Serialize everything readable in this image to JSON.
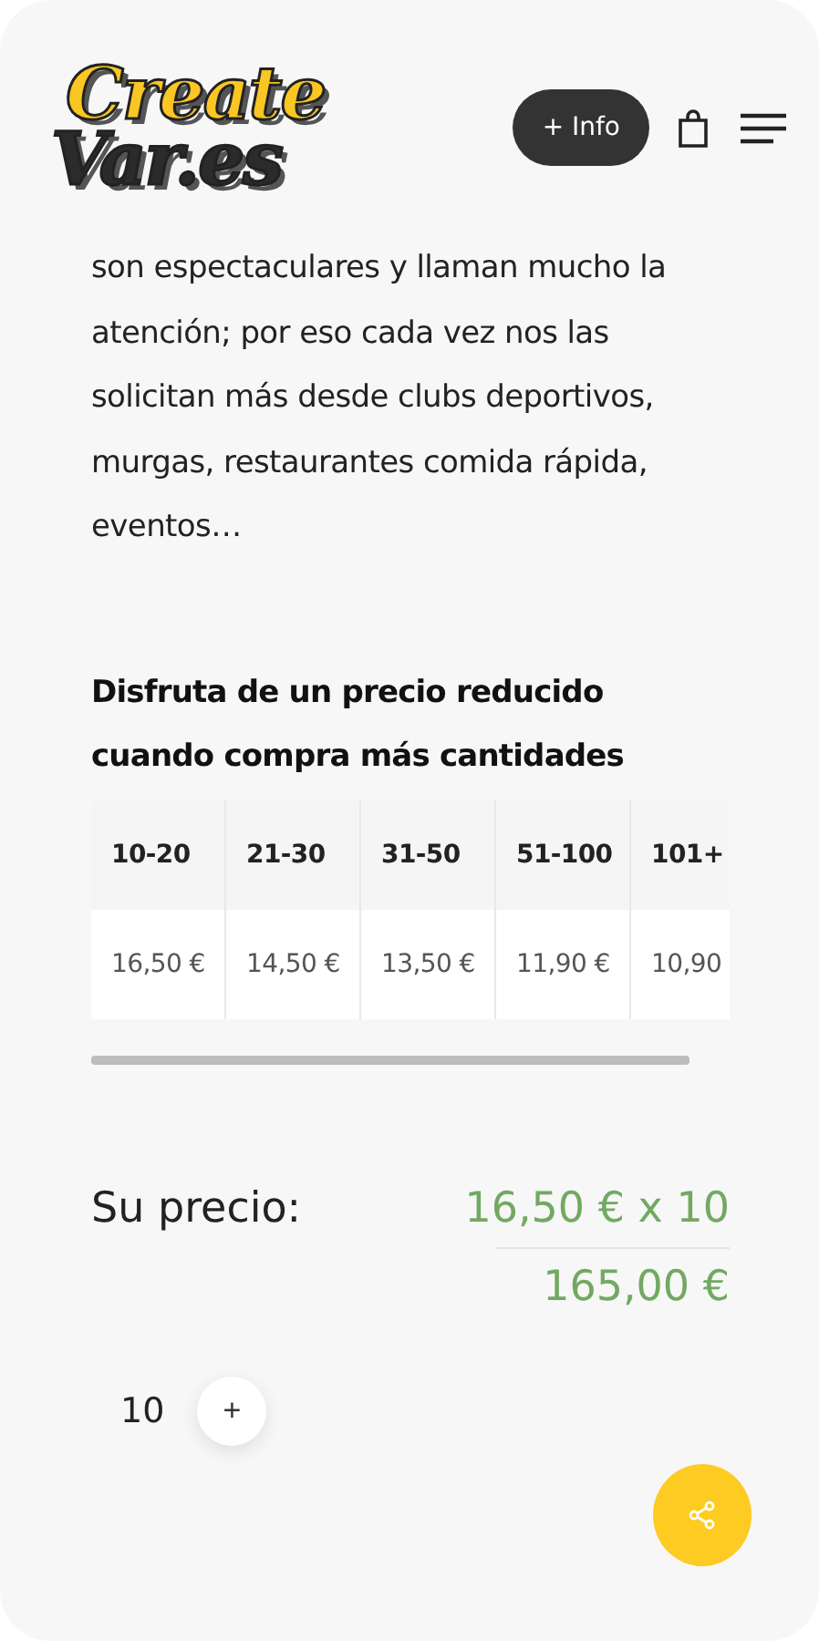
{
  "header": {
    "logo": [
      "Create",
      "Var.es"
    ],
    "info_button": "+ Info"
  },
  "description": "son espectaculares y llaman mucho la atención; por eso cada vez nos las solicitan más desde clubs deportivos, murgas, restaurantes comida rápida, eventos…",
  "discount": {
    "title": "Disfruta de un precio reducido cuando compra más cantidades",
    "columns": [
      "10-20",
      "21-30",
      "31-50",
      "51-100",
      "101+"
    ],
    "prices": [
      "16,50 €",
      "14,50 €",
      "13,50 €",
      "11,90 €",
      "10,90"
    ]
  },
  "price": {
    "label": "Su precio:",
    "unit": "16,50 € x 10",
    "total": "165,00 €"
  },
  "quantity": {
    "value": "10",
    "plus": "+"
  }
}
